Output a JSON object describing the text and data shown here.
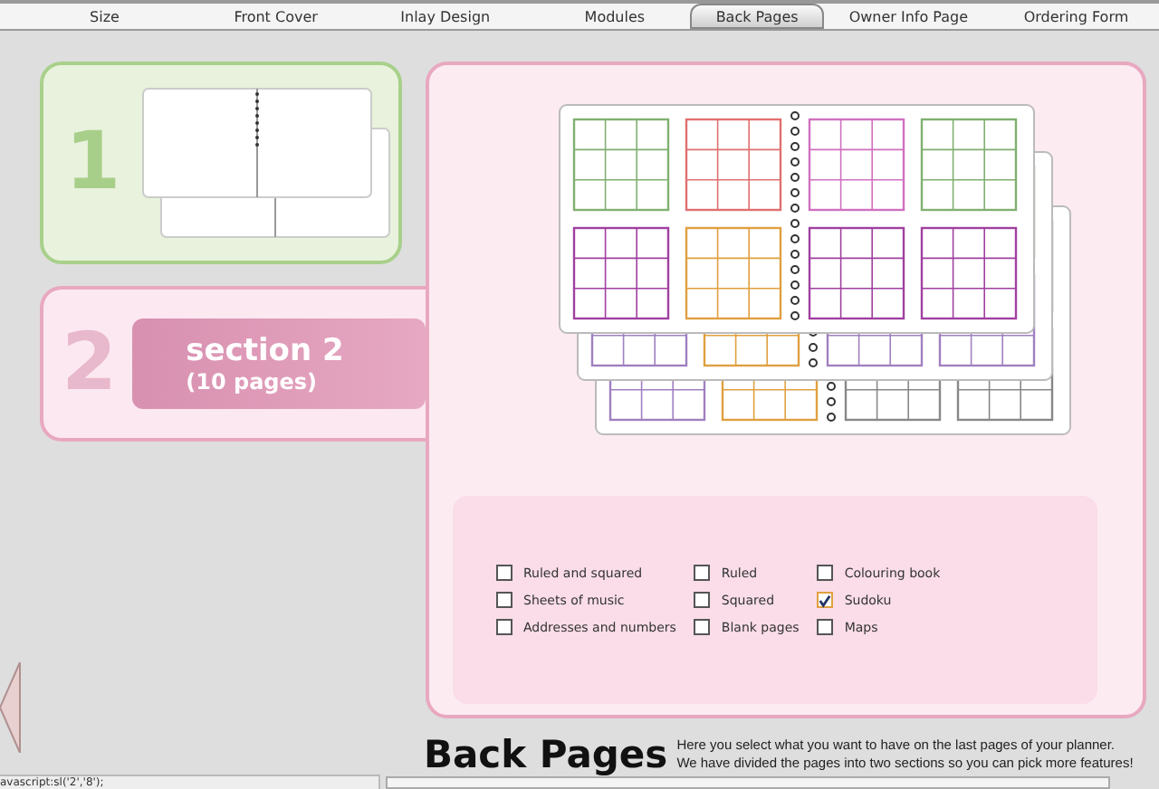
{
  "tabs": [
    {
      "label": "Size",
      "selected": false
    },
    {
      "label": "Front Cover",
      "selected": false
    },
    {
      "label": "Inlay Design",
      "selected": false
    },
    {
      "label": "Modules",
      "selected": false
    },
    {
      "label": "Back Pages",
      "selected": true
    },
    {
      "label": "Owner Info Page",
      "selected": false
    },
    {
      "label": "Ordering Form",
      "selected": false
    }
  ],
  "sections": [
    {
      "number": "1",
      "selected": false
    },
    {
      "number": "2",
      "selected": true,
      "title": "section 2",
      "subtitle": "(10 pages)"
    }
  ],
  "options": [
    {
      "label": "Ruled and squared",
      "checked": false
    },
    {
      "label": "Ruled",
      "checked": false
    },
    {
      "label": "Colouring book",
      "checked": false
    },
    {
      "label": "Sheets of music",
      "checked": false
    },
    {
      "label": "Squared",
      "checked": false
    },
    {
      "label": "Sudoku",
      "checked": true
    },
    {
      "label": "Addresses and numbers",
      "checked": false
    },
    {
      "label": "Blank pages",
      "checked": false
    },
    {
      "label": "Maps",
      "checked": false
    }
  ],
  "heading": "Back Pages",
  "description": [
    "Here you select what you want to have on the last pages of your planner.",
    "We have divided the pages into two sections so you can pick more features!"
  ],
  "status_bar": {
    "text": "avascript:sl('2','8');"
  }
}
